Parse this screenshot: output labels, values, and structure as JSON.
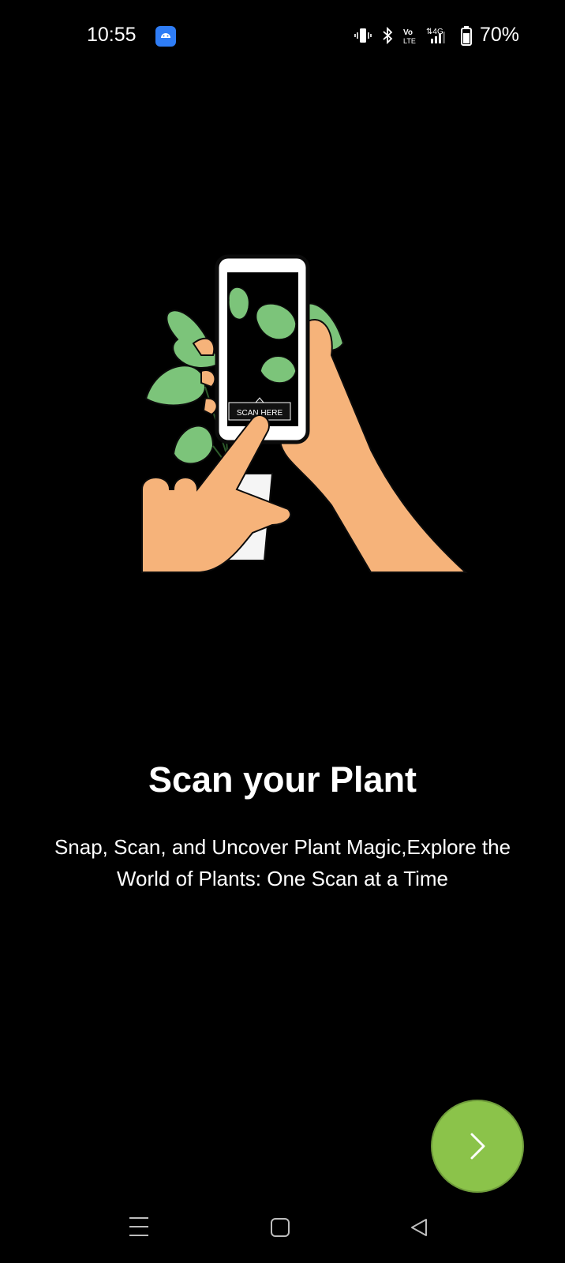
{
  "status_bar": {
    "time": "10:55",
    "battery": "70%",
    "icons": [
      "android-notification-icon",
      "vibrate-icon",
      "bluetooth-icon",
      "volte-icon",
      "4g-signal-icon",
      "battery-icon"
    ]
  },
  "illustration": {
    "label": "SCAN HERE",
    "icon": "hand-holding-phone-scanning-plant-illustration"
  },
  "onboarding": {
    "title": "Scan your Plant",
    "subtitle": "Snap, Scan, and Uncover Plant Magic,Explore the World of Plants: One Scan at a Time"
  },
  "next_button": {
    "icon": "chevron-right-icon",
    "color": "#8bc34a"
  },
  "nav_bar": {
    "icons": [
      "menu-icon",
      "home-icon",
      "back-icon"
    ]
  }
}
